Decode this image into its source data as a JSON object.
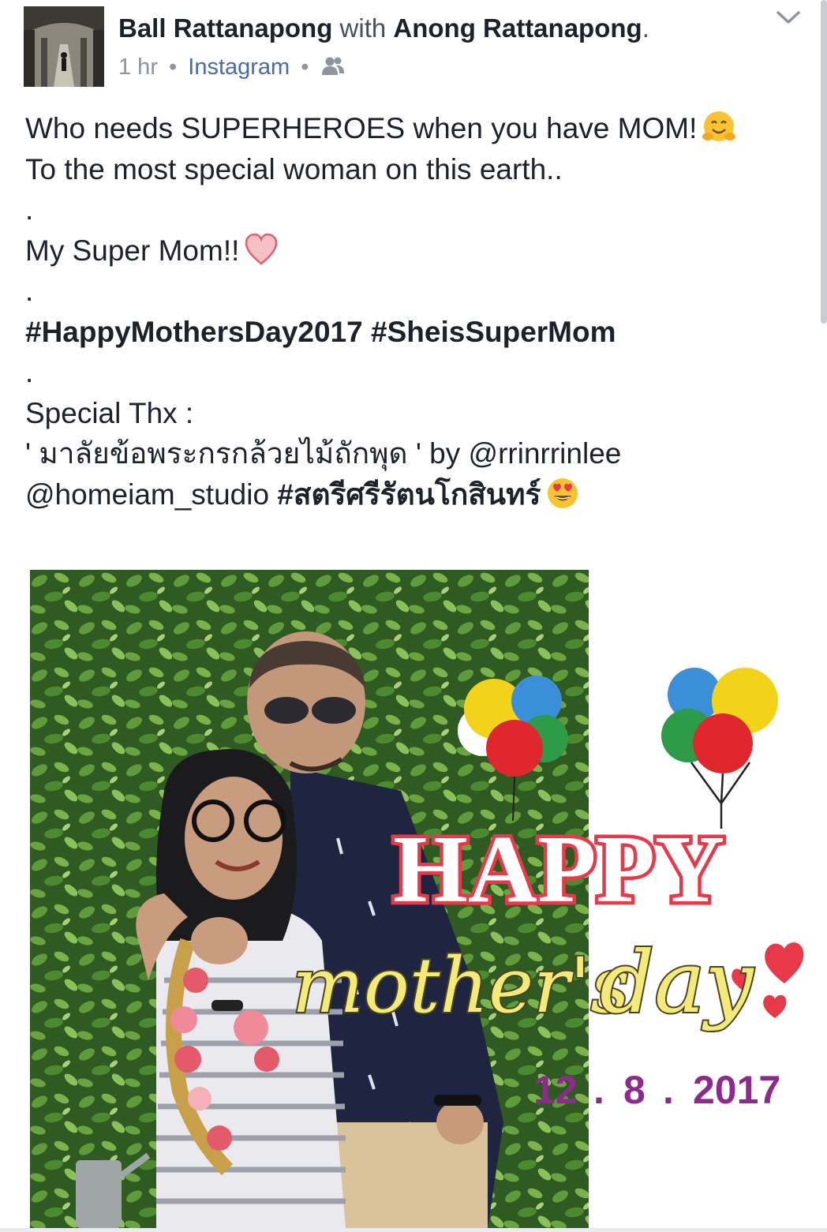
{
  "post": {
    "author": "Ball Rattanapong",
    "with_word": "with",
    "tagged": "Anong Rattanapong",
    "period": ".",
    "time": "1 hr",
    "separator": "•",
    "source": "Instagram",
    "audience_icon": "friends-icon",
    "menu_icon": "chevron-down-icon",
    "lines": {
      "line1": "Who needs SUPERHEROES when you have MOM!",
      "line2": "To the most special woman on this earth..",
      "dot1": ".",
      "line3": "My Super Mom!!",
      "dot2": ".",
      "hashtag1": "#HappyMothersDay2017",
      "hashtag2": "#SheisSuperMom",
      "dot3": ".",
      "line4": "Special Thx :",
      "line5_quote": "' มาลัยข้อพระกรกล้วยไม้ถักพุด '",
      "line5_by": "by @rrinrrinlee",
      "line6_handle": "@homeiam_studio",
      "line6_tag": "#สตรีศรีรัตนโกสินทร์"
    },
    "emojis": [
      "hugging-face-emoji",
      "heart-emoji",
      "heart-eyes-emoji"
    ]
  },
  "photo": {
    "word_happy": "HAPPY",
    "word_mothers": "mother's",
    "word_day": "day",
    "date_day": "12",
    "date_sep1": ".",
    "date_month": "8",
    "date_sep2": ".",
    "date_year": "2017"
  },
  "colors": {
    "text": "#1d2129",
    "meta": "#90949c",
    "link": "#4b6aa6",
    "happy_red": "#e8394a",
    "script_yellow": "#f3ea7a",
    "date_purple": "#8e2a8e"
  }
}
